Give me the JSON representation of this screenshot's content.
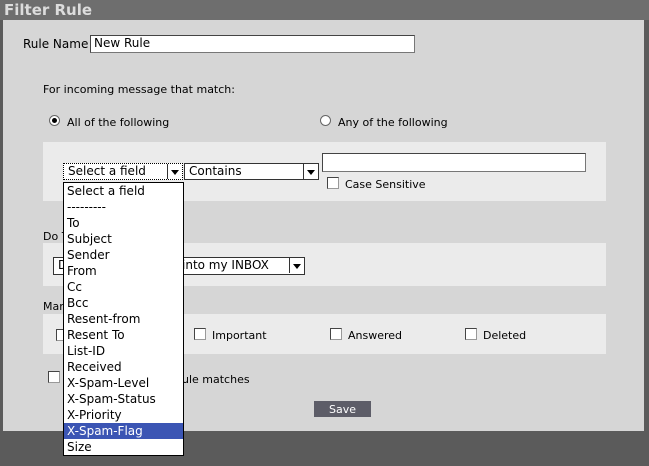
{
  "window": {
    "title": "Filter Rule"
  },
  "rule_name": {
    "label": "Rule Name :",
    "value": "New Rule"
  },
  "match_section": {
    "heading": "For incoming message that match:",
    "radio_all_label": "All of the following",
    "radio_any_label": "Any of the following",
    "selected": "all"
  },
  "condition": {
    "field_select_value": "Select a field",
    "operator_select_value": "Contains",
    "value_input": "",
    "case_sensitive_label": "Case Sensitive"
  },
  "field_options": [
    "Select a field",
    "---------",
    "To",
    "Subject",
    "Sender",
    "From",
    "Cc",
    "Bcc",
    "Resent-from",
    "Resent To",
    "List-ID",
    "Received",
    "X-Spam-Level",
    "X-Spam-Status",
    "X-Priority",
    "X-Spam-Flag",
    "Size"
  ],
  "field_options_highlighted": "X-Spam-Flag",
  "action": {
    "heading_visible": "Do T",
    "select_value_visible": "into my INBOX",
    "select_prefix_visible": "D"
  },
  "mark": {
    "heading_visible": "Mar",
    "important_label": "Important",
    "answered_label": "Answered",
    "deleted_label": "Deleted"
  },
  "stop": {
    "label_visible": "ule matches"
  },
  "buttons": {
    "save": "Save"
  },
  "colors": {
    "background": "#5b5b5b",
    "panel": "#d6d6d6",
    "inner_box": "#ebebeb",
    "highlight": "#3b55b4",
    "save_button": "#5d5d68"
  }
}
